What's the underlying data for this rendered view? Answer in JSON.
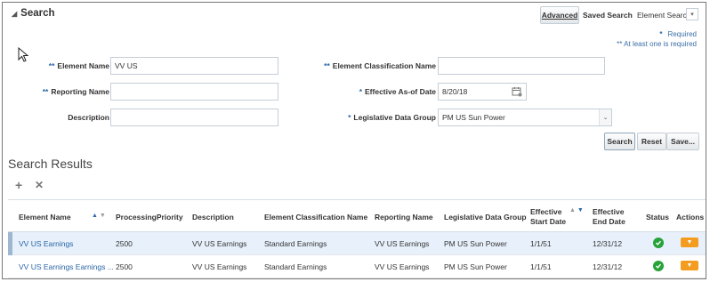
{
  "search": {
    "title": "Search",
    "advanced_label": "Advanced",
    "saved_search_label": "Saved Search",
    "saved_search_value": "Element Search",
    "required_note": "Required",
    "required_marker": "*",
    "at_least_one_note": "** At least one is required",
    "fields": {
      "element_name": {
        "label": "Element Name",
        "marker": "**",
        "value": "VV US"
      },
      "reporting_name": {
        "label": "Reporting Name",
        "marker": "**",
        "value": ""
      },
      "description": {
        "label": "Description",
        "value": ""
      },
      "element_classification_name": {
        "label": "Element Classification Name",
        "marker": "**",
        "value": ""
      },
      "effective_as_of_date": {
        "label": "Effective As-of Date",
        "marker": "*",
        "value": "8/20/18"
      },
      "legislative_data_group": {
        "label": "Legislative Data Group",
        "marker": "*",
        "value": "PM US Sun Power"
      }
    },
    "buttons": {
      "search": "Search",
      "reset": "Reset",
      "save": "Save..."
    }
  },
  "results": {
    "title": "Search Results",
    "add_icon": "+",
    "remove_icon": "✕",
    "columns": {
      "element_name": "Element Name",
      "processing_priority": "ProcessingPriority",
      "description": "Description",
      "element_classification_name": "Element Classification Name",
      "reporting_name": "Reporting Name",
      "legislative_data_group": "Legislative Data Group",
      "effective_start_date_1": "Effective",
      "effective_start_date_2": "Start Date",
      "effective_end_date_1": "Effective",
      "effective_end_date_2": "End Date",
      "status": "Status",
      "actions": "Actions"
    },
    "rows": [
      {
        "element_name": "VV US Earnings",
        "processing_priority": "2500",
        "description": "VV US Earnings",
        "classification": "Standard Earnings",
        "reporting_name": "VV US Earnings",
        "ldg": "PM US Sun Power",
        "start": "1/1/51",
        "end": "12/31/12"
      },
      {
        "element_name": "VV US Earnings Earnings ...",
        "processing_priority": "2500",
        "description": "VV US Earnings",
        "classification": "Standard Earnings",
        "reporting_name": "VV US Earnings",
        "ldg": "PM US Sun Power",
        "start": "1/1/51",
        "end": "12/31/12"
      }
    ]
  },
  "colors": {
    "accent": "#2a66a8",
    "status_ok": "#27a33a",
    "action": "#f39c1f",
    "selected_row": "#e8f1fb"
  }
}
